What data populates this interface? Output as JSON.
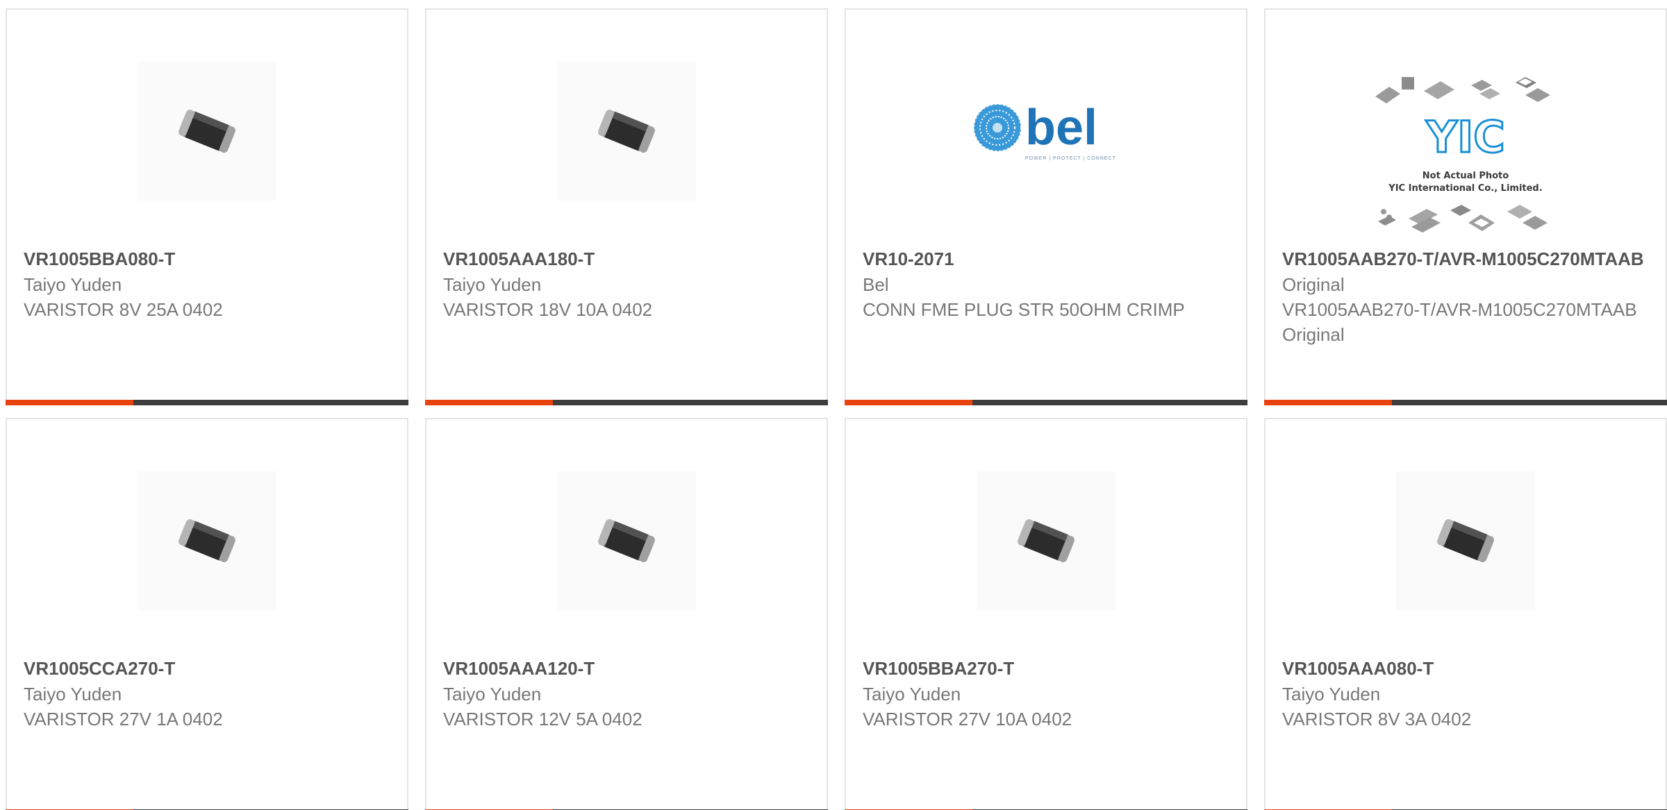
{
  "products": [
    {
      "part_number": "VR1005BBA080-T",
      "manufacturer": "Taiyo Yuden",
      "description": "VARISTOR 8V 25A 0402",
      "image": "varistor-chip-icon"
    },
    {
      "part_number": "VR1005AAA180-T",
      "manufacturer": "Taiyo Yuden",
      "description": "VARISTOR 18V 10A 0402",
      "image": "varistor-chip-icon"
    },
    {
      "part_number": "VR10-2071",
      "manufacturer": "Bel",
      "description": "CONN FME PLUG STR 50OHM CRIMP",
      "image": "bel-logo"
    },
    {
      "part_number": "VR1005AAB270-T/AVR-M1005C270MTAAB",
      "manufacturer": "Original",
      "description": "VR1005AAB270-T/AVR-M1005C270MTAAB Original",
      "image": "yic-placeholder",
      "image_caption": [
        "Not Actual Photo",
        "YIC International Co., Limited."
      ]
    },
    {
      "part_number": "VR1005CCA270-T",
      "manufacturer": "Taiyo Yuden",
      "description": "VARISTOR 27V 1A 0402",
      "image": "varistor-chip-icon"
    },
    {
      "part_number": "VR1005AAA120-T",
      "manufacturer": "Taiyo Yuden",
      "description": "VARISTOR 12V 5A 0402",
      "image": "varistor-chip-icon"
    },
    {
      "part_number": "VR1005BBA270-T",
      "manufacturer": "Taiyo Yuden",
      "description": "VARISTOR 27V 10A 0402",
      "image": "varistor-chip-icon"
    },
    {
      "part_number": "VR1005AAA080-T",
      "manufacturer": "Taiyo Yuden",
      "description": "VARISTOR 8V 3A 0402",
      "image": "varistor-chip-icon"
    }
  ],
  "bel_logo": {
    "wordmark": "bel",
    "tagline": "POWER | PROTECT | CONNECT"
  },
  "yic_logo": {
    "wordmark": "YIC"
  },
  "colors": {
    "accent": "#e8430e",
    "bar": "#3d3d3d",
    "border": "#e4e4e4",
    "part_number": "#555555",
    "text": "#777777",
    "bel_blue": "#1f73b7"
  }
}
